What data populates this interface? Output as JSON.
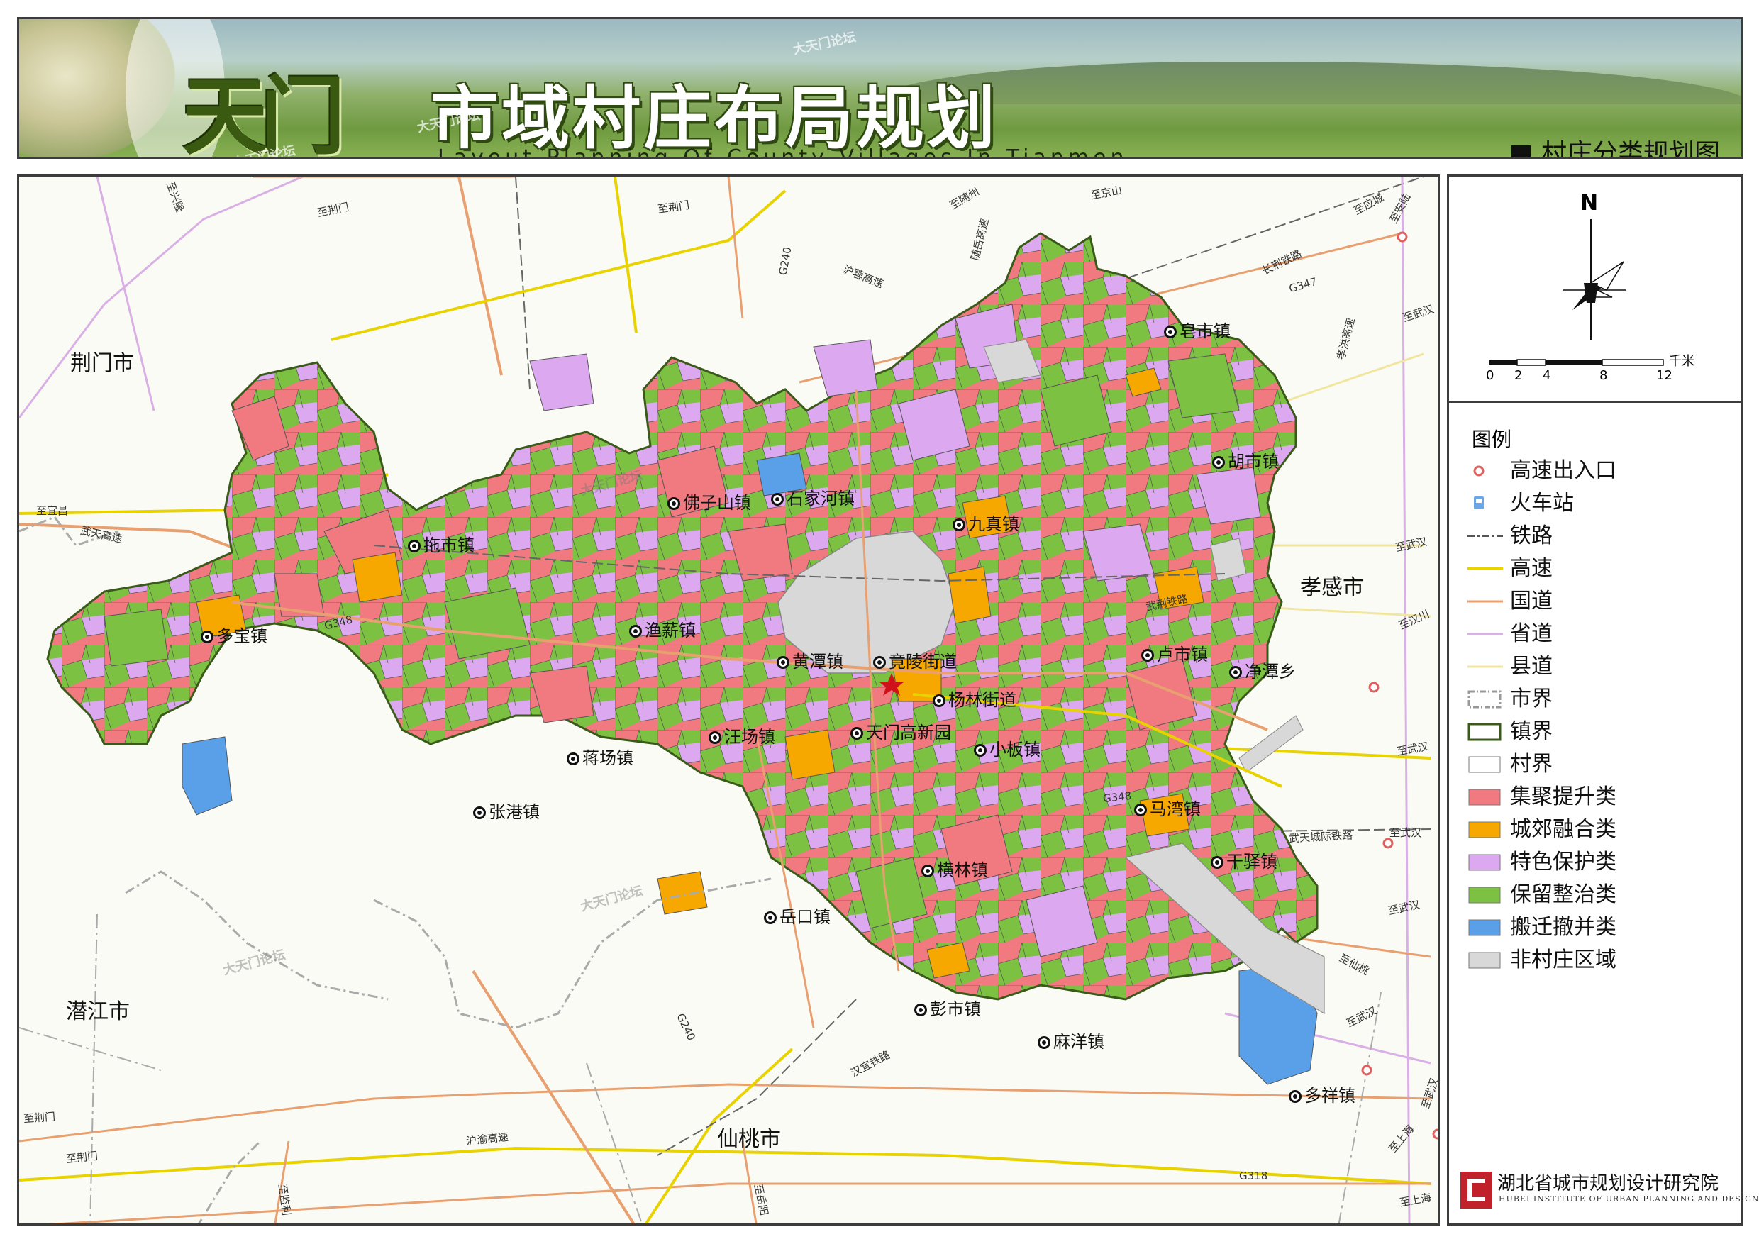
{
  "banner": {
    "title_tian": "天门",
    "title_main": "市域村庄布局规划",
    "title_en": "Layout Planning Of County Villages In Tianmen",
    "subtitle": "■ 村庄分类规划图",
    "watermark": "大天门论坛"
  },
  "map": {
    "cities": {
      "jingmen": "荆门市",
      "xiaogan": "孝感市",
      "qianjiang": "潜江市",
      "xiantao": "仙桃市"
    },
    "towns": {
      "tuoshi": "拖市镇",
      "duobao": "多宝镇",
      "fozishan": "佛子山镇",
      "shijiahe": "石家河镇",
      "jiuzhen": "九真镇",
      "zaoshi": "皂市镇",
      "hushi": "胡市镇",
      "yuxin": "渔薪镇",
      "huangtan": "黄潭镇",
      "jingling": "竟陵街道",
      "yanglin": "杨林街道",
      "lushi": "卢市镇",
      "jingtan": "净潭乡",
      "wangchang": "汪场镇",
      "gaoxinyuan": "天门高新园",
      "xiaoban": "小板镇",
      "jiangchang": "蒋场镇",
      "zhanggang": "张港镇",
      "mawan": "马湾镇",
      "ganyi": "干驿镇",
      "henglin": "横林镇",
      "yuekou": "岳口镇",
      "pengshi": "彭市镇",
      "mayang": "麻洋镇",
      "duoxiang": "多祥镇"
    },
    "roads": {
      "zhi_xingyi": "至兴隆",
      "zhi_jingmen_top": "至荆门",
      "zhi_jingmen_top2": "至荆门",
      "g240_top": "G240",
      "hurong": "沪蓉高速",
      "suiyue": "随岳高速",
      "zhi_jingshan": "至京山",
      "zhi_suizhou": "至随州",
      "zhi_yingcheng": "至应城",
      "zhi_anlu": "至安陆",
      "changjing": "长荆铁路",
      "g347": "G347",
      "zhi_wuhan1": "至武汉",
      "xiaohong": "孝洪高速",
      "zhi_yichang": "至宜昌",
      "wutian": "武天高速",
      "g348_left": "G348",
      "zhi_wuhan2": "至武汉",
      "wujing": "武荆铁路",
      "zhi_hanchuan": "至汉川",
      "zhi_wuhan3": "至武汉",
      "g348_right": "G348",
      "wutian_rail": "武天城际铁路",
      "zhi_wuhan4": "至武汉",
      "zhi_wuhan5": "至武汉",
      "zhi_xiantao": "至仙桃",
      "zhi_wuhan6": "至武汉",
      "zhi_wuhan7": "至武汉",
      "zhi_shanghai1": "至上海",
      "zhi_shanghai2": "至上海",
      "g240_bottom": "G240",
      "hanyi": "汉宜铁路",
      "zhi_jingmen_bl": "至荆门",
      "zhi_jingmen_bl2": "至荆门",
      "huyu": "沪渝高速",
      "zhi_jianli": "至监利",
      "zhi_yuezhou": "至岳阳",
      "g318": "G318"
    },
    "watermark": "大天门论坛"
  },
  "compass": {
    "north": "N",
    "unit": "千米",
    "ticks": [
      "0",
      "2",
      "4",
      "8",
      "12"
    ]
  },
  "legend": {
    "title": "图例",
    "items": [
      {
        "label": "高速出入口",
        "icon": "interchange-icon"
      },
      {
        "label": "火车站",
        "icon": "train-station-icon"
      },
      {
        "label": "铁路",
        "icon": "railway-line"
      },
      {
        "label": "高速",
        "icon": "expressway-line",
        "color": "#e8d200"
      },
      {
        "label": "国道",
        "icon": "national-road-line",
        "color": "#e8a070"
      },
      {
        "label": "省道",
        "icon": "provincial-road-line",
        "color": "#d9b0e6"
      },
      {
        "label": "县道",
        "icon": "county-road-line",
        "color": "#f0e6a0"
      },
      {
        "label": "市界",
        "icon": "city-boundary"
      },
      {
        "label": "镇界",
        "icon": "town-boundary",
        "color": "#3a5a1a"
      },
      {
        "label": "村界",
        "icon": "village-boundary"
      },
      {
        "label": "集聚提升类",
        "icon": "swatch",
        "color": "#f07a80"
      },
      {
        "label": "城郊融合类",
        "icon": "swatch",
        "color": "#f7a800"
      },
      {
        "label": "特色保护类",
        "icon": "swatch",
        "color": "#dca8f0"
      },
      {
        "label": "保留整治类",
        "icon": "swatch",
        "color": "#7cc142"
      },
      {
        "label": "搬迁撤并类",
        "icon": "swatch",
        "color": "#5aa0e8"
      },
      {
        "label": "非村庄区域",
        "icon": "swatch",
        "color": "#d8d8d8"
      }
    ]
  },
  "institute": {
    "name_cn": "湖北省城市规划设计研究院",
    "name_en": "HUBEI INSTITUTE OF URBAN PLANNING AND DESIGN"
  }
}
